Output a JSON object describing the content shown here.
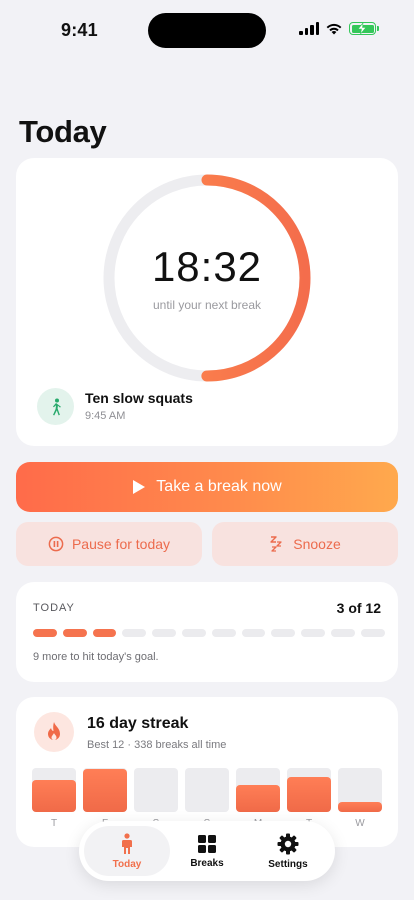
{
  "status_bar": {
    "time": "9:41"
  },
  "page": {
    "title": "Today"
  },
  "timer": {
    "countdown": "18:32",
    "subtitle": "until your next break",
    "progress_fraction": 0.5
  },
  "next_break": {
    "title": "Ten slow squats",
    "time": "9:45 AM",
    "icon": "walking-person-icon"
  },
  "actions": {
    "primary": "Take a break now",
    "pause": "Pause for today",
    "snooze": "Snooze"
  },
  "progress": {
    "label": "TODAY",
    "count": "3 of 12",
    "completed": 3,
    "total": 12,
    "note": "9 more to hit today's goal."
  },
  "streak": {
    "title": "16 day streak",
    "subtitle": "Best 12 · 338 breaks all time",
    "days": [
      {
        "label": "T",
        "value": 0.72
      },
      {
        "label": "F",
        "value": 0.98
      },
      {
        "label": "S",
        "value": 0
      },
      {
        "label": "S",
        "value": 0
      },
      {
        "label": "M",
        "value": 0.62
      },
      {
        "label": "T",
        "value": 0.8
      },
      {
        "label": "W",
        "value": 0.22
      }
    ]
  },
  "tabbar": {
    "items": [
      {
        "label": "Today",
        "icon": "person-icon",
        "active": true
      },
      {
        "label": "Breaks",
        "icon": "grid-icon",
        "active": false
      },
      {
        "label": "Settings",
        "icon": "gear-icon",
        "active": false
      }
    ]
  },
  "colors": {
    "accent": "#f1704c",
    "accent_light": "#f8e2df",
    "green": "#34c759",
    "background": "#f2f2f6"
  }
}
